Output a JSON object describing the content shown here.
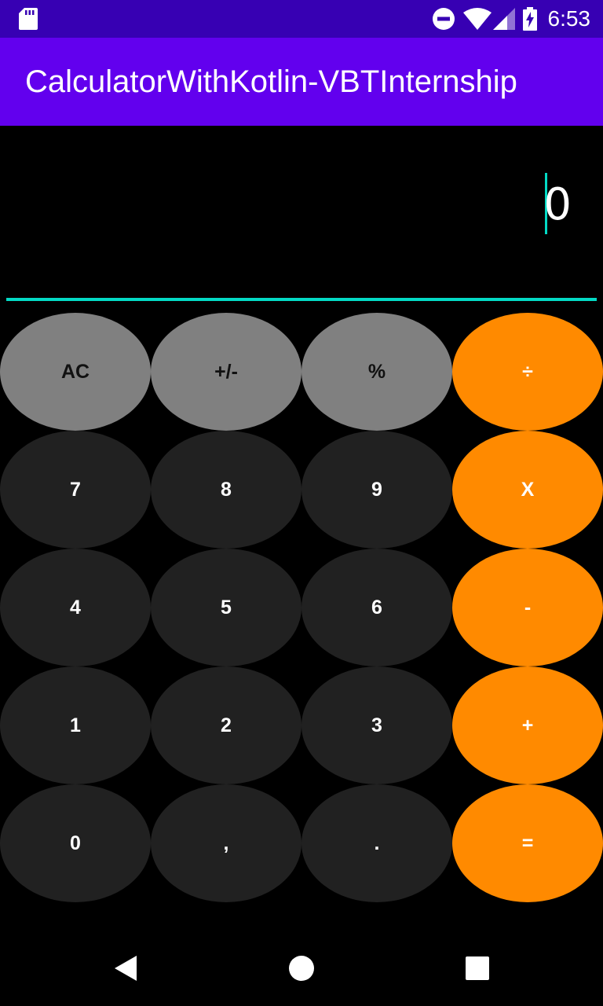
{
  "status_bar": {
    "time": "6:53",
    "icons": [
      "sd-card-icon",
      "do-not-disturb-icon",
      "wifi-icon",
      "cell-signal-icon",
      "battery-charging-icon"
    ]
  },
  "app_bar": {
    "title": "CalculatorWithKotlin-VBTInternship",
    "color": "#6200EE"
  },
  "display": {
    "value": "0",
    "accent_color": "#03DAC5"
  },
  "keypad": {
    "rows": [
      [
        "AC",
        "+/-",
        "%",
        "÷"
      ],
      [
        "7",
        "8",
        "9",
        "X"
      ],
      [
        "4",
        "5",
        "6",
        "-"
      ],
      [
        "1",
        "2",
        "3",
        "+"
      ],
      [
        "0",
        ",",
        ".",
        "="
      ]
    ],
    "colors": {
      "function": "#808080",
      "digit": "#212121",
      "operator": "#FF8A00"
    }
  },
  "nav_bar": {
    "icons": [
      "back-icon",
      "home-icon",
      "recents-icon"
    ]
  }
}
